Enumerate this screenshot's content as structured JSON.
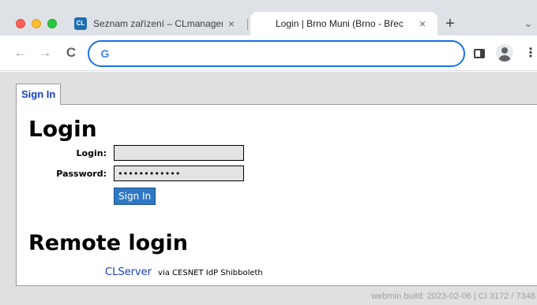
{
  "browser": {
    "tabs": [
      {
        "title": "Seznam zařízení – CLmanager",
        "favicon": "CL",
        "active": false
      },
      {
        "title": "Login | Brno Muni (Brno - Břec",
        "active": true
      }
    ],
    "close_glyph": "×",
    "new_tab_glyph": "+",
    "tab_search_glyph": "⌄",
    "nav": {
      "back": "←",
      "forward": "→",
      "reload": "C"
    },
    "omnibox": {
      "value": "",
      "icon": "google-g-icon",
      "icon_glyph": "G"
    },
    "menu_glyph": "⋮"
  },
  "page": {
    "tab_label": "Sign In",
    "login_heading": "Login",
    "login_label": "Login:",
    "login_value": "",
    "password_label": "Password:",
    "password_value": "••••••••••••",
    "sign_in_button": "Sign In",
    "remote_heading": "Remote login",
    "remote_link": "CLServer",
    "remote_via": "via CESNET IdP Shibboleth",
    "footer": "webmin build: 2023-02-06 | CI 3172 / 7348"
  },
  "colors": {
    "accent": "#1a73e8",
    "link": "#1a3fbf",
    "button": "#2f78c4",
    "page_bg": "#e0e0e0"
  }
}
